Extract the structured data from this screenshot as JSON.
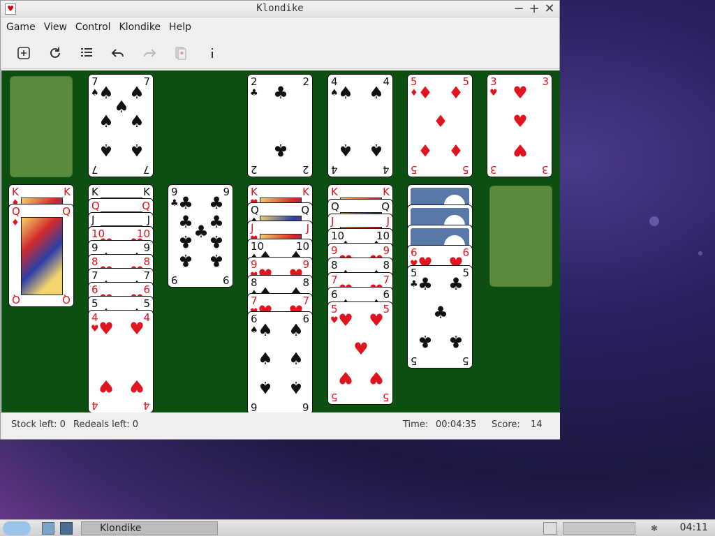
{
  "window": {
    "title": "Klondike",
    "minimize": "−",
    "maximize": "+",
    "close": "✕"
  },
  "menu": [
    "Game",
    "View",
    "Control",
    "Klondike",
    "Help"
  ],
  "toolbar": [
    "new-game",
    "restart",
    "list",
    "undo",
    "redo",
    "deal",
    "info"
  ],
  "foundations": [
    {
      "rank": "2",
      "suit": "♣",
      "color": "black"
    },
    {
      "rank": "4",
      "suit": "♠",
      "color": "black"
    },
    {
      "rank": "5",
      "suit": "♦",
      "color": "red"
    },
    {
      "rank": "3",
      "suit": "♥",
      "color": "red"
    }
  ],
  "waste": {
    "rank": "7",
    "suit": "♠",
    "color": "black"
  },
  "tableau": [
    {
      "hidden": 0,
      "cards": [
        [
          "K",
          "♦",
          "red"
        ],
        [
          "Q",
          "♦",
          "red"
        ]
      ]
    },
    {
      "hidden": 0,
      "cards": [
        [
          "K",
          "♠",
          "black"
        ],
        [
          "Q",
          "♥",
          "red"
        ],
        [
          "J",
          "♠",
          "black"
        ],
        [
          "10",
          "♥",
          "red"
        ],
        [
          "9",
          "♠",
          "black"
        ],
        [
          "8",
          "♥",
          "red"
        ],
        [
          "7",
          "♠",
          "black"
        ],
        [
          "6",
          "♥",
          "red"
        ],
        [
          "5",
          "♠",
          "black"
        ],
        [
          "4",
          "♥",
          "red"
        ]
      ]
    },
    {
      "hidden": 0,
      "cards": [
        [
          "9",
          "♣",
          "black"
        ]
      ]
    },
    {
      "hidden": 0,
      "cards": [
        [
          "K",
          "♥",
          "red"
        ],
        [
          "Q",
          "♠",
          "black"
        ],
        [
          "J",
          "♥",
          "red"
        ],
        [
          "10",
          "♠",
          "black"
        ],
        [
          "9",
          "♥",
          "red"
        ],
        [
          "8",
          "♠",
          "black"
        ],
        [
          "7",
          "♥",
          "red"
        ],
        [
          "6",
          "♠",
          "black"
        ]
      ]
    },
    {
      "hidden": 0,
      "cards": [
        [
          "K",
          "♥",
          "red"
        ],
        [
          "Q",
          "♠",
          "black"
        ],
        [
          "J",
          "♥",
          "red"
        ],
        [
          "10",
          "♠",
          "black"
        ],
        [
          "9",
          "♥",
          "red"
        ],
        [
          "8",
          "♠",
          "black"
        ],
        [
          "7",
          "♥",
          "red"
        ],
        [
          "6",
          "♠",
          "black"
        ],
        [
          "5",
          "♥",
          "red"
        ]
      ]
    },
    {
      "hidden": 3,
      "cards": [
        [
          "6",
          "♥",
          "red"
        ],
        [
          "5",
          "♣",
          "black"
        ]
      ]
    },
    {
      "hidden": 0,
      "cards": []
    }
  ],
  "status": {
    "stock": "Stock left: 0",
    "redeals": "Redeals left: 0",
    "time_label": "Time:",
    "time": "00:04:35",
    "score_label": "Score:",
    "score": "14"
  },
  "taskbar": {
    "app": "Klondike",
    "clock": "04:11"
  },
  "colors": {
    "felt": "#0c4f10",
    "slot": "#5a8a3e",
    "red": "#e0141e"
  }
}
